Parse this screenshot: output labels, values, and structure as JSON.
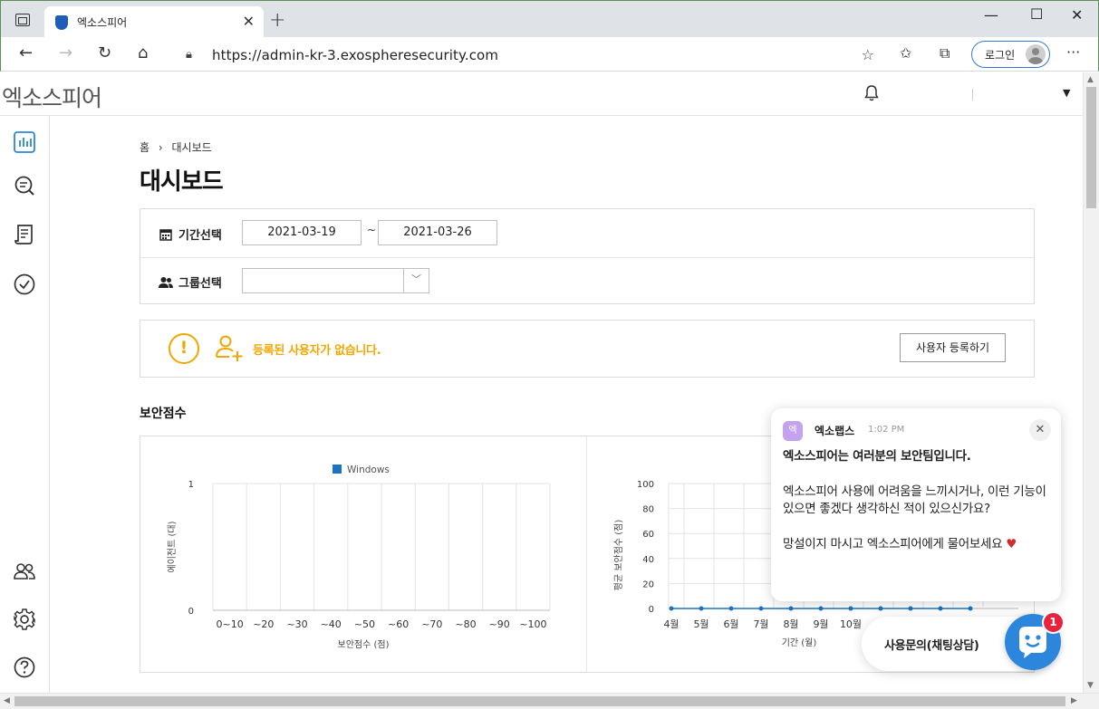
{
  "browser": {
    "tab_title": "엑소스피어",
    "url": "https://admin-kr-3.exospheresecurity.com",
    "login_label": "로그인"
  },
  "header": {
    "logo": "엑소스피어"
  },
  "breadcrumb": {
    "home": "홈",
    "separator": "›",
    "current": "대시보드"
  },
  "page": {
    "title": "대시보드"
  },
  "filters": {
    "period_label": "기간선택",
    "start_date": "2021-03-19",
    "separator": "~",
    "end_date": "2021-03-26",
    "group_label": "그룹선택",
    "group_value": ""
  },
  "notice": {
    "text": "등록된 사용자가 없습니다.",
    "button": "사용자 등록하기"
  },
  "security_score": {
    "title": "보안점수"
  },
  "chart_data": [
    {
      "type": "bar",
      "legend": [
        "Windows"
      ],
      "categories": [
        "0~10",
        "~20",
        "~30",
        "~40",
        "~50",
        "~60",
        "~70",
        "~80",
        "~90",
        "~100"
      ],
      "series": [
        {
          "name": "Windows",
          "values": [
            0,
            0,
            0,
            0,
            0,
            0,
            0,
            0,
            0,
            0
          ]
        }
      ],
      "ylabel": "에이전트 (대)",
      "xlabel": "보안점수 (점)",
      "ylim": [
        0,
        1
      ],
      "yticks": [
        "0",
        "1"
      ],
      "grid": true
    },
    {
      "type": "line",
      "categories": [
        "4월",
        "5월",
        "6월",
        "7월",
        "8월",
        "9월",
        "10월"
      ],
      "series": [
        {
          "values": [
            0,
            0,
            0,
            0,
            0,
            0,
            0,
            0,
            0,
            0,
            0
          ]
        }
      ],
      "ylabel": "평균 보안점수 (점)",
      "xlabel": "기간 (월)",
      "ylim": [
        0,
        100
      ],
      "yticks": [
        "0",
        "20",
        "40",
        "60",
        "80",
        "100"
      ],
      "grid": true
    }
  ],
  "chat": {
    "sender": "엑소랩스",
    "avatar_letter": "엑",
    "time": "1:02 PM",
    "heading": "엑소스피어는 여러분의 보안팀입니다.",
    "paragraph1": "엑소스피어 사용에 어려움을 느끼시거나, 이런 기능이 있으면 좋겠다 생각하신 적이 있으신가요?",
    "paragraph2": "망설이지 마시고 엑소스피어에게 물어보세요",
    "launcher_label": "사용문의(채팅상담)",
    "badge_count": "1"
  },
  "colors": {
    "accent": "#2b86dc",
    "warning": "#f0a800",
    "series": "#1a73c6",
    "badge": "#e8233d"
  }
}
